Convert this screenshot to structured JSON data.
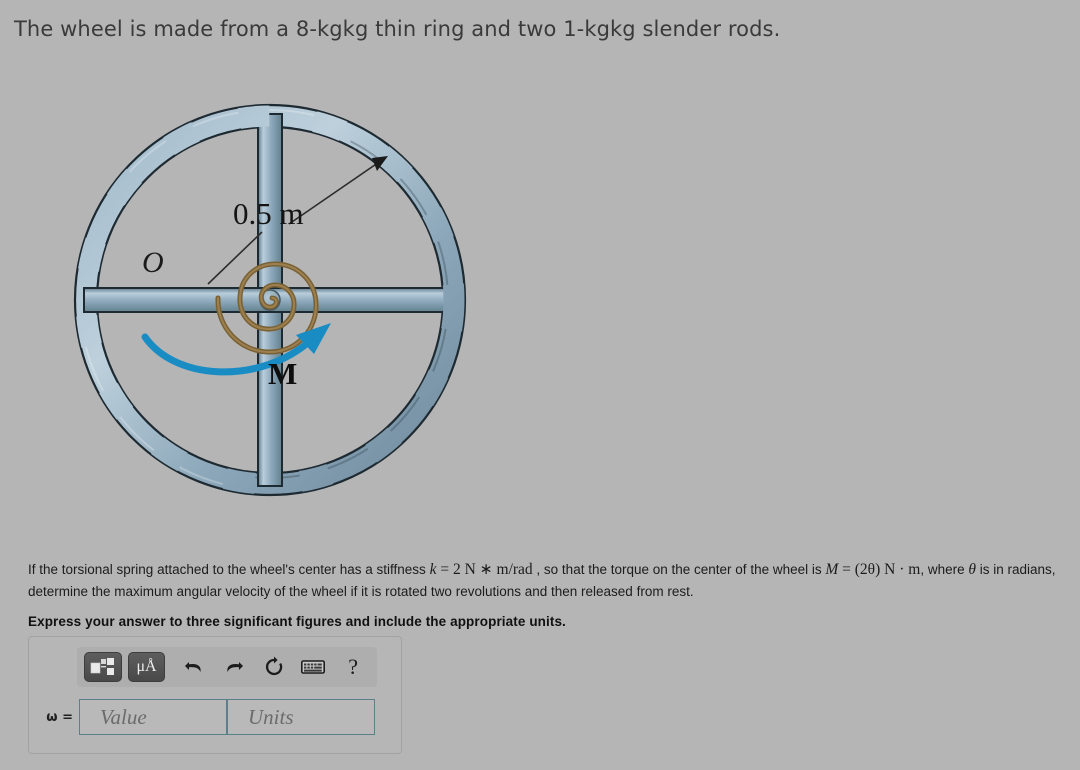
{
  "problem": {
    "intro": "The wheel is made from a 8-kgkg thin ring and two 1-kgkg slender rods.",
    "question_line1_a": "If the torsional spring attached to the wheel's center has a stiffness ",
    "question_k": "k",
    "question_eq": " = 2",
    "question_units_k": " N ∗ m/rad",
    "question_line1_b": " , so that the torque on the center of the wheel is ",
    "question_M": "M",
    "question_M_eq": " = (2θ)",
    "question_M_units": " N · m",
    "question_line1_c": ", where ",
    "question_theta": "θ",
    "question_line1_d": " is in radians, determine the maximum angular velocity of the wheel if it is rotated two revolutions and then released from rest.",
    "instruction": "Express your answer to three significant figures and include the appropriate units."
  },
  "figure": {
    "center_label": "O",
    "radius_label": "0.5 m",
    "moment_label": "M",
    "colors": {
      "ring_light": "#aec4d2",
      "ring_mid": "#8aa6b8",
      "ring_dark": "#6e8a9c",
      "ring_outline": "#1e2a31",
      "spring": "#7a6134",
      "arrow_blue": "#1a8cc4",
      "leader": "#3a3a3a"
    }
  },
  "answer": {
    "toolbar": {
      "template_button": "math-template",
      "units_button": "μÅ",
      "undo": "undo",
      "redo": "redo",
      "reset": "reset",
      "keyboard": "keyboard",
      "help": "?"
    },
    "variable_label": "ω =",
    "value_placeholder": "Value",
    "units_placeholder": "Units"
  }
}
